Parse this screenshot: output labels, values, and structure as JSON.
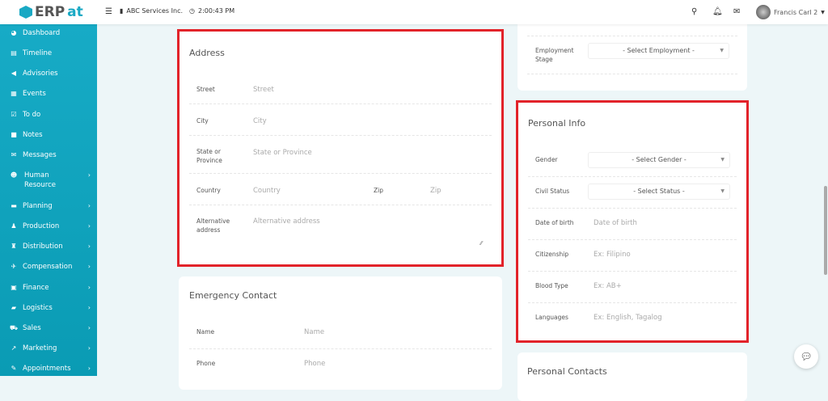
{
  "brand": {
    "name_main": "ERP",
    "name_accent": "at"
  },
  "topbar": {
    "company": "ABC Services Inc.",
    "time": "2:00:43 PM",
    "user": "Francis Carl 2"
  },
  "sidebar": [
    {
      "label": "Dashboard",
      "icon": "dashboard-icon",
      "glyph": "◕"
    },
    {
      "label": "Timeline",
      "icon": "timeline-icon",
      "glyph": "▤"
    },
    {
      "label": "Advisories",
      "icon": "megaphone-icon",
      "glyph": "◀"
    },
    {
      "label": "Events",
      "icon": "calendar-icon",
      "glyph": "▦"
    },
    {
      "label": "To do",
      "icon": "checkbox-icon",
      "glyph": "☑"
    },
    {
      "label": "Notes",
      "icon": "note-icon",
      "glyph": "■"
    },
    {
      "label": "Messages",
      "icon": "envelope-icon",
      "glyph": "✉"
    },
    {
      "label": "Human Resource",
      "icon": "users-icon",
      "glyph": "☻",
      "chev": true
    },
    {
      "label": "Planning",
      "icon": "briefcase-icon",
      "glyph": "▬",
      "chev": true
    },
    {
      "label": "Production",
      "icon": "production-icon",
      "glyph": "♟",
      "chev": true
    },
    {
      "label": "Distribution",
      "icon": "bank-icon",
      "glyph": "♜",
      "chev": true
    },
    {
      "label": "Compensation",
      "icon": "compensation-icon",
      "glyph": "✈",
      "chev": true
    },
    {
      "label": "Finance",
      "icon": "money-icon",
      "glyph": "▣",
      "chev": true
    },
    {
      "label": "Logistics",
      "icon": "truck-icon",
      "glyph": "▰",
      "chev": true
    },
    {
      "label": "Sales",
      "icon": "cart-icon",
      "glyph": "⛟",
      "chev": true
    },
    {
      "label": "Marketing",
      "icon": "chart-icon",
      "glyph": "↗",
      "chev": true
    },
    {
      "label": "Appointments",
      "icon": "edit-icon",
      "glyph": "✎",
      "chev": true
    }
  ],
  "address": {
    "title": "Address",
    "street_label": "Street",
    "street_ph": "Street",
    "city_label": "City",
    "city_ph": "City",
    "state_label": "State or Province",
    "state_ph": "State or Province",
    "country_label": "Country",
    "country_ph": "Country",
    "zip_label": "Zip",
    "zip_ph": "Zip",
    "alt_label": "Alternative address",
    "alt_ph": "Alternative address"
  },
  "emergency": {
    "title": "Emergency Contact",
    "name_label": "Name",
    "name_ph": "Name",
    "phone_label": "Phone",
    "phone_ph": "Phone"
  },
  "employment": {
    "stage_label": "Employment Stage",
    "stage_value": "- Select Employment -"
  },
  "personal": {
    "title": "Personal Info",
    "gender_label": "Gender",
    "gender_value": "- Select Gender -",
    "civil_label": "Civil Status",
    "civil_value": "- Select Status -",
    "dob_label": "Date of birth",
    "dob_ph": "Date of birth",
    "citizenship_label": "Citizenship",
    "citizenship_ph": "Ex: Filipino",
    "blood_label": "Blood Type",
    "blood_ph": "Ex: AB+",
    "languages_label": "Languages",
    "languages_ph": "Ex: English, Tagalog"
  },
  "contacts": {
    "title": "Personal Contacts"
  }
}
